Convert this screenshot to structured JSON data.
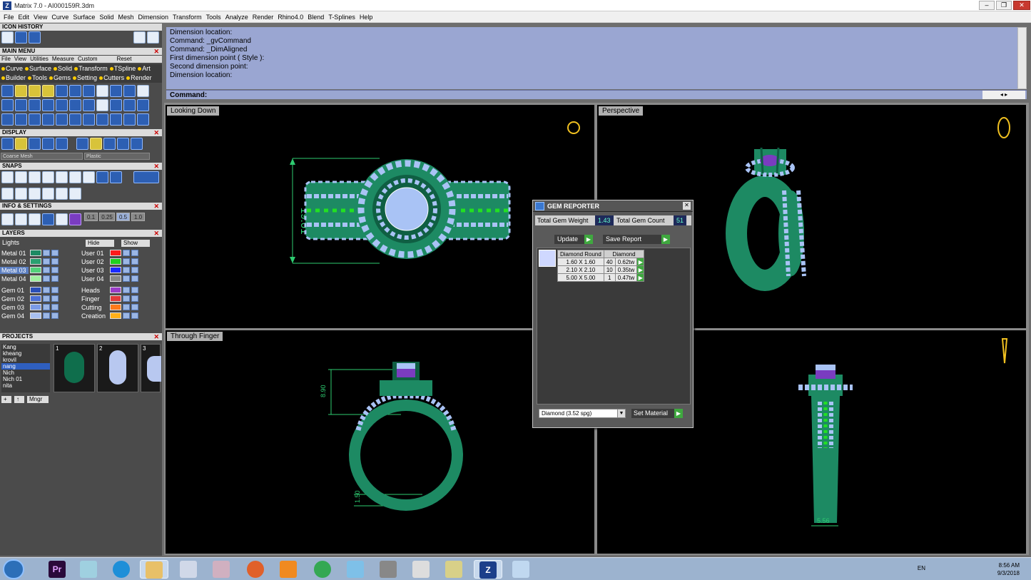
{
  "window": {
    "title": "Matrix 7.0 - AI000159R.3dm",
    "app_icon": "Z",
    "minimize": "–",
    "maximize": "❐",
    "close": "✕"
  },
  "menu": [
    "File",
    "Edit",
    "View",
    "Curve",
    "Surface",
    "Solid",
    "Mesh",
    "Dimension",
    "Transform",
    "Tools",
    "Analyze",
    "Render",
    "Rhino4.0",
    "Blend",
    "T-Splines",
    "Help"
  ],
  "left": {
    "icon_history": "ICON HISTORY",
    "main_menu": "MAIN MENU",
    "main_menu_links": [
      "File",
      "View",
      "Utilities",
      "Measure",
      "Custom"
    ],
    "reset": "Reset",
    "cats_row1": [
      "Curve",
      "Surface",
      "Solid",
      "Transform",
      "TSpline",
      "Art"
    ],
    "cats_row2": [
      "Builder",
      "Tools",
      "Gems",
      "Setting",
      "Cutters",
      "Render"
    ],
    "display": "DISPLAY",
    "display_mesh": "Coarse Mesh",
    "display_material": "Plastic",
    "snaps": "SNAPS",
    "snap_values": [
      "0.1",
      "0.25",
      "0.5",
      "1.0"
    ],
    "info": "INFO & SETTINGS",
    "layers": "LAYERS",
    "lights": "Lights",
    "hide": "Hide",
    "show": "Show",
    "layers_left": [
      "Metal 01",
      "Metal 02",
      "Metal 03",
      "Metal 04",
      "Gem 01",
      "Gem 02",
      "Gem 03",
      "Gem 04"
    ],
    "layers_right": [
      "User 01",
      "User 02",
      "User 03",
      "User 04",
      "Heads",
      "Finger",
      "Cutting",
      "Creation"
    ],
    "projects": "PROJECTS",
    "project_names": [
      "Kang",
      "kheang",
      "kroviI",
      "nang",
      "Nich",
      "Nich 01",
      "nita"
    ],
    "thumb_numbers": [
      "1",
      "2",
      "3"
    ],
    "mngr": "Mngr"
  },
  "command": {
    "history": [
      "Dimension location:",
      "Command: _gvCommand",
      "Command: _DimAligned",
      "First dimension point ( Style ):",
      "Second dimension point:",
      "Dimension location:"
    ],
    "label": "Command:"
  },
  "viewports": {
    "top_left": "Looking Down",
    "top_right": "Perspective",
    "bottom_left": "Through Finger",
    "dim_top": "19.01",
    "dim_height": "8.90",
    "dim_bottom": "1.50",
    "dim_width": "5.56"
  },
  "gem_reporter": {
    "title": "GEM REPORTER",
    "total_weight_label": "Total Gem Weight",
    "total_weight": "1.43",
    "total_count_label": "Total Gem Count",
    "total_count": "51",
    "update": "Update",
    "save_report": "Save Report",
    "col_shape": "Diamond Round",
    "col_material": "Diamond",
    "rows": [
      {
        "size": "1.60 X 1.60",
        "count": "40",
        "weight": "0.62tw"
      },
      {
        "size": "2.10 X 2.10",
        "count": "10",
        "weight": "0.35tw"
      },
      {
        "size": "5.00 X 5.00",
        "count": "1",
        "weight": "0.47tw"
      }
    ],
    "material_select": "Diamond    (3.52 spg)",
    "set_material": "Set Material",
    "go_icon": "▶"
  },
  "taskbar": {
    "apps": [
      "Pr",
      "",
      "",
      "",
      "",
      "",
      "",
      "",
      "",
      "",
      "",
      "",
      "",
      "",
      "Z",
      ""
    ],
    "lang": "EN",
    "time": "8:56 AM",
    "date": "9/3/2018"
  },
  "colors": {
    "metal": "#1d8a63",
    "metal_dark": "#0f5f43",
    "gem": "#a9c3f5",
    "accent_gem": "#22e022",
    "cmd_bg": "#9aa6d2"
  }
}
